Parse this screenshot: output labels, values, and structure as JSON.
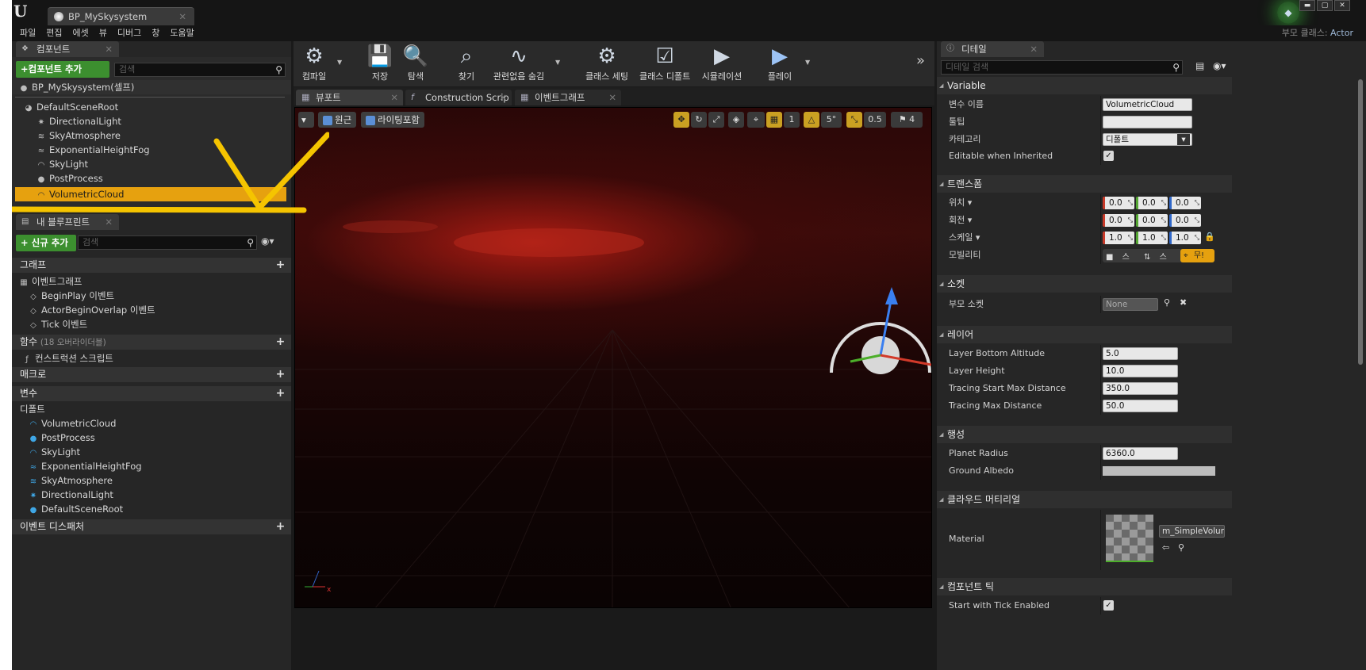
{
  "window": {
    "doc_tab": "BP_MySkysystem",
    "parent_class_label": "부모 클래스:",
    "parent_class_value": "Actor",
    "controls": [
      "▬",
      "▢",
      "✕"
    ]
  },
  "menu": [
    "파일",
    "편집",
    "에셋",
    "뷰",
    "디버그",
    "창",
    "도움말"
  ],
  "components": {
    "tab": "컴포넌트",
    "add_button": "+컴포넌트 추가",
    "search_placeholder": "검색",
    "self": "BP_MySkysystem(셀프)",
    "items": [
      {
        "label": "DefaultSceneRoot",
        "icon": "scene-root-icon"
      },
      {
        "label": "DirectionalLight",
        "icon": "directional-light-icon"
      },
      {
        "label": "SkyAtmosphere",
        "icon": "sky-atmosphere-icon"
      },
      {
        "label": "ExponentialHeightFog",
        "icon": "height-fog-icon"
      },
      {
        "label": "SkyLight",
        "icon": "sky-light-icon"
      },
      {
        "label": "PostProcess",
        "icon": "post-process-icon"
      },
      {
        "label": "VolumetricCloud",
        "icon": "volumetric-cloud-icon",
        "selected": true
      }
    ]
  },
  "blueprint": {
    "tab": "내 블루프린트",
    "add_button": "신규 추가",
    "search_placeholder": "검색",
    "graph_section": "그래프",
    "event_graph": "이벤트그래프",
    "events": [
      "BeginPlay 이벤트",
      "ActorBeginOverlap 이벤트",
      "Tick 이벤트"
    ],
    "functions_section": "함수",
    "functions_note": "(18 오버라이더블)",
    "construction_script": "컨스트럭션 스크립트",
    "macros_section": "매크로",
    "variables_section": "변수",
    "default_section": "디폴트",
    "default_vars": [
      "VolumetricCloud",
      "PostProcess",
      "SkyLight",
      "ExponentialHeightFog",
      "SkyAtmosphere",
      "DirectionalLight",
      "DefaultSceneRoot"
    ],
    "dispatchers_section": "이벤트 디스패처"
  },
  "toolbar": {
    "compile": "컴파일",
    "save": "저장",
    "browse": "탐색",
    "find": "찾기",
    "hide_unrelated": "관련없음 숨김",
    "class_settings": "클래스 세팅",
    "class_defaults": "클래스 디폴트",
    "simulation": "시뮬레이션",
    "play": "플레이",
    "overflow": "»"
  },
  "editor_tabs": [
    "뷰포트",
    "Construction Scrip",
    "이벤트그래프"
  ],
  "viewport": {
    "perspective": "원근",
    "lighting": "라이팅포함",
    "grid_snap": "1",
    "rotation_snap": "5°",
    "scale_snap": "0.5",
    "camera_speed": "4"
  },
  "details": {
    "tab": "디테일",
    "search_placeholder": "디테일 검색",
    "sections": {
      "variable": "Variable",
      "transform": "트랜스폼",
      "sockets": "소켓",
      "layers": "레이어",
      "planet": "행성",
      "cloud_material": "클라우드 머티리얼",
      "component_tick": "컴포넌트 틱"
    },
    "variable_name_label": "변수 이름",
    "variable_name": "VolumetricCloud",
    "tooltip_label": "툴팁",
    "tooltip_value": "",
    "category_label": "카테고리",
    "category_value": "디폴트",
    "editable_label": "Editable when Inherited",
    "location_label": "위치 ▾",
    "location": [
      "0.0",
      "0.0",
      "0.0"
    ],
    "rotation_label": "회전 ▾",
    "rotation": [
      "0.0",
      "0.0",
      "0.0"
    ],
    "scale_label": "스케일 ▾",
    "scale": [
      "1.0",
      "1.0",
      "1.0"
    ],
    "mobility_label": "모빌리티",
    "mobility_options": [
      "스",
      "스",
      "무!"
    ],
    "parent_socket_label": "부모 소켓",
    "parent_socket_value": "None",
    "layer_bottom_label": "Layer Bottom Altitude",
    "layer_bottom_value": "5.0",
    "layer_height_label": "Layer Height",
    "layer_height_value": "10.0",
    "tracing_start_label": "Tracing Start Max Distance",
    "tracing_start_value": "350.0",
    "tracing_max_label": "Tracing Max Distance",
    "tracing_max_value": "50.0",
    "planet_radius_label": "Planet Radius",
    "planet_radius_value": "6360.0",
    "ground_albedo_label": "Ground Albedo",
    "material_label": "Material",
    "material_value": "m_SimpleVolum",
    "tick_label": "Start with Tick Enabled"
  },
  "colors": {
    "selection": "#e6a10f",
    "add_button": "#3c8f2f",
    "annotation": "#f5c400"
  }
}
